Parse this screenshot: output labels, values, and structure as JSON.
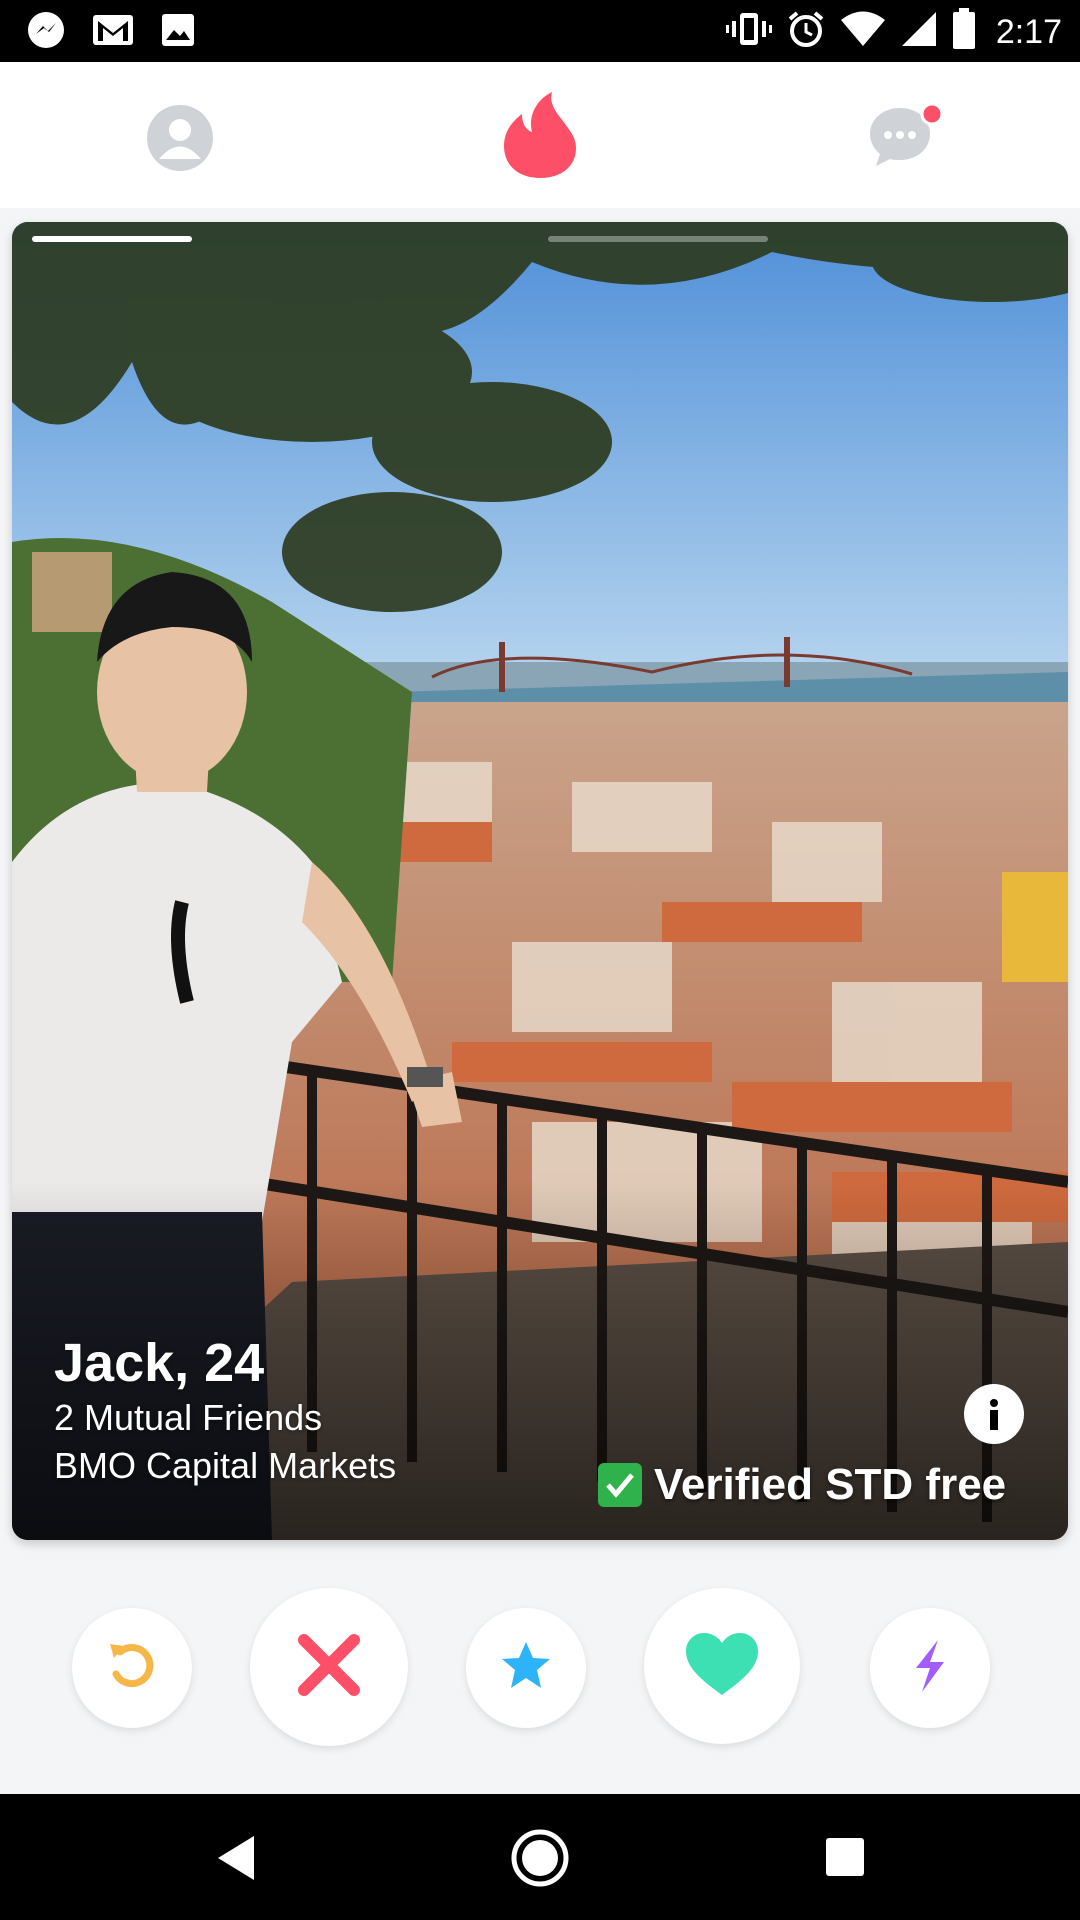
{
  "status_bar": {
    "time": "2:17",
    "left_icons": [
      "messenger-icon",
      "gmail-icon",
      "image-icon"
    ],
    "right_icons": [
      "vibrate-icon",
      "alarm-icon",
      "wifi-icon",
      "signal-icon",
      "battery-icon"
    ]
  },
  "top_bar": {
    "icons": [
      "profile-icon",
      "flame-icon",
      "messages-icon"
    ],
    "accent": "#fd5068",
    "notification_dot_color": "#fd5068"
  },
  "card": {
    "name_age": "Jack, 24",
    "mutual_friends": "2 Mutual Friends",
    "work": "BMO Capital Markets",
    "verified_text": "Verified STD free",
    "photo_index": 1,
    "photo_count": 3
  },
  "actions": [
    {
      "name": "rewind-icon",
      "color": "#f5b748"
    },
    {
      "name": "nope-icon",
      "color": "#fd5068"
    },
    {
      "name": "super-like-icon",
      "color": "#2db3f7"
    },
    {
      "name": "like-icon",
      "color": "#3de0b2"
    },
    {
      "name": "boost-icon",
      "color": "#a35dfc"
    }
  ],
  "nav_bar": {
    "icons": [
      "back-icon",
      "home-icon",
      "recents-icon"
    ]
  }
}
